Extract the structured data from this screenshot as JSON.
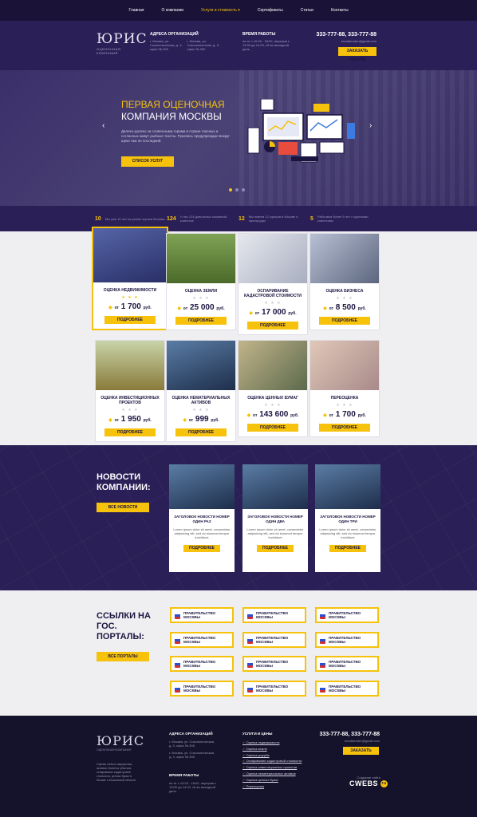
{
  "nav": {
    "items": [
      "Главная",
      "О компании",
      "Услуги и стоимость ▾",
      "Сертификаты",
      "Статьи",
      "Контакты"
    ]
  },
  "header": {
    "logo_text": "ЮРИС",
    "logo_sub": "ОЦЕНОЧНАЯ КОМПАНИЯ",
    "address_title": "АДРЕСА ОРГАНИЗАЦИЙ",
    "address_1": "г. Москва, ул. Сокольническая, д. 3, офис № 300",
    "address_2": "г. Москва, ул. Сокольническая, д. 3, офис № 300",
    "hours_title": "ВРЕМЯ РАБОТЫ",
    "hours": "пн-пт с 10:00 - 18:00, перерыв с 13:00 до 14:00, сб-вс выходной день",
    "phone": "333-777-88, 333-777-88",
    "email": "emailsender@gmail.com",
    "callback_label": "ЗАКАЗАТЬ ЗВОНОК"
  },
  "hero": {
    "title_line1": "ПЕРВАЯ ОЦЕНОЧНАЯ",
    "title_line2": "КОМПАНИЯ МОСКВЫ",
    "desc": "Далеко-далеко за словесными горами в стране гласных и согласных живут рыбные тексты. Рукопись предупреждал вокруг щеки там не последний.",
    "button": "СПИСОК УСЛУГ"
  },
  "stats": [
    {
      "num": "10",
      "text": "Мы уже 10 лет на рынке оценки Москвы"
    },
    {
      "num": "124",
      "text": "У нас 124 довольных компаний-клиентов"
    },
    {
      "num": "12",
      "text": "Мы имеем 12 офисов в Москве и пригородах"
    },
    {
      "num": "5",
      "text": "Работаем более 5 лет с крупными клиентами"
    }
  ],
  "services": [
    {
      "title": "ОЦЕНКА НЕДВИЖИМОСТИ",
      "price": "1 700",
      "currency": "руб.",
      "prefix": "от",
      "button": "ПОДРОБНЕЕ",
      "color": "#3c4c8c"
    },
    {
      "title": "ОЦЕНКА ЗЕМЛИ",
      "price": "25 000",
      "currency": "руб.",
      "prefix": "от",
      "button": "ПОДРОБНЕЕ",
      "color": "#6c8a3a"
    },
    {
      "title": "ОСПАРИВАНИЕ КАДАСТРОВОЙ СТОИМОСТИ",
      "price": "17 000",
      "currency": "руб.",
      "prefix": "от",
      "button": "ПОДРОБНЕЕ",
      "color": "#c8ccd8"
    },
    {
      "title": "ОЦЕНКА БИЗНЕСА",
      "price": "8 500",
      "currency": "руб.",
      "prefix": "от",
      "button": "ПОДРОБНЕЕ",
      "color": "#8a94ac"
    },
    {
      "title": "ОЦЕНКА ИНВЕСТИЦИОННЫХ ПРОЕКТОВ",
      "price": "1 950",
      "currency": "руб.",
      "prefix": "от",
      "button": "ПОДРОБНЕЕ",
      "color": "#8a7a3a"
    },
    {
      "title": "ОЦЕНКА НЕМАТЕРИАЛЬНЫХ АКТИВОВ",
      "price": "999",
      "currency": "руб.",
      "prefix": "от",
      "button": "ПОДРОБНЕЕ",
      "color": "#3a5a84"
    },
    {
      "title": "ОЦЕНКА ЦЕННЫХ БУМАГ",
      "price": "143 600",
      "currency": "руб.",
      "prefix": "от",
      "button": "ПОДРОБНЕЕ",
      "color": "#7a8a6a"
    },
    {
      "title": "ПЕРЕОЦЕНКА",
      "price": "1 700",
      "currency": "руб.",
      "prefix": "от",
      "button": "ПОДРОБНЕЕ",
      "color": "#b4a0a0"
    }
  ],
  "news": {
    "title_line1": "НОВОСТИ",
    "title_line2": "КОМПАНИИ:",
    "all_button": "ВСЕ НОВОСТИ",
    "items": [
      {
        "title": "ЗАГОЛОВОК НОВОСТИ НОМЕР ОДИН РАЗ",
        "text": "Lorem ipsum dolor sit amet, consectetur adipisicing elit, sed do eiusmod tempor incididunt",
        "button": "ПОДРОБНЕЕ"
      },
      {
        "title": "ЗАГОЛОВОК НОВОСТИ НОМЕР ОДИН ДВА",
        "text": "Lorem ipsum dolor sit amet, consectetur adipisicing elit, sed do eiusmod tempor incididunt",
        "button": "ПОДРОБНЕЕ"
      },
      {
        "title": "ЗАГОЛОВОК НОВОСТИ НОМЕР ОДИН ТРИ",
        "text": "Lorem ipsum dolor sit amet, consectetur adipisicing elit, sed do eiusmod tempor incididunt",
        "button": "ПОДРОБНЕЕ"
      }
    ]
  },
  "gov": {
    "title_line1": "ССЫЛКИ НА",
    "title_line2": "ГОС.",
    "title_line3": "ПОРТАЛЫ:",
    "all_button": "ВСЕ ПОРТАЛЫ",
    "link_label_1": "ПРАВИТЕЛЬСТВО",
    "link_label_2": "МОСКВЫ"
  },
  "footer": {
    "logo_text": "ЮРИС",
    "logo_sub": "ОЦЕНОЧНАЯ КОМПАНИЯ",
    "desc": "Оценка любого имущества, активов, бизнеса, убытков, оспаривание кадастровой стоимости, ценных бумаг в Москве и Московской области.",
    "address_title": "АДРЕСА ОРГАНИЗАЦИЙ",
    "address_1": "г. Москва, ул. Сокольническая, д. 3, офис № 305",
    "address_2": "г. Москва, ул. Сокольническая, д. 3, офис № 305",
    "hours_title": "ВРЕМЯ РАБОТЫ",
    "hours": "пн-пт с 10:00 - 18:00, перерыв с 13:00 до 14:00, сб-вс выходной день.",
    "services_title": "УСЛУГИ И ЦЕНЫ",
    "services": [
      "Оценка недвижимости",
      "Оценка земли",
      "Оценка ущерба",
      "Оспаривание кадастровой стоимости",
      "Оценка инвестиционных проектов",
      "Оценка нематериальных активов",
      "Оценка ценных бумаг",
      "Переоценка"
    ],
    "phone": "333-777-88, 333-777-88",
    "email": "emailsender@gmail.com",
    "callback_label": "ЗАКАЗАТЬ ЗВОНОК",
    "maker_line": "Создание сайта",
    "maker_brand": "CWEBS"
  }
}
